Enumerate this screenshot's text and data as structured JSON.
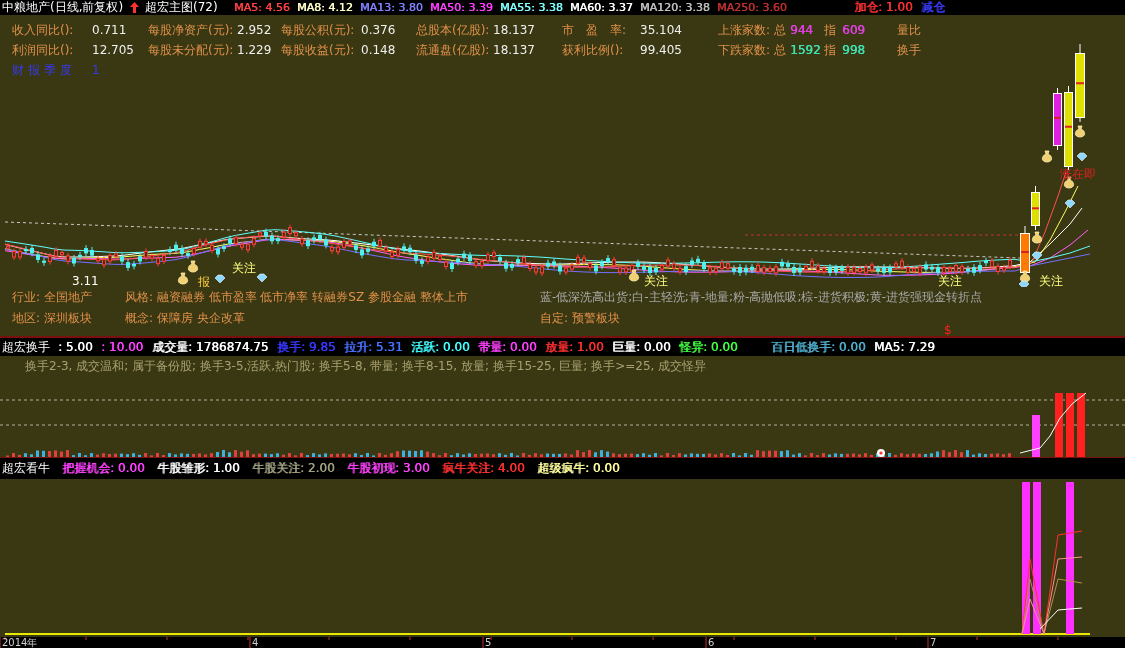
{
  "title_bar": {
    "stock": "中粮地产(日线,前复权)",
    "indicator": "超宏主图(72)",
    "moving_averages": [
      {
        "label": "MA5: 4.56",
        "color": "#ff4040"
      },
      {
        "label": "MA8: 4.12",
        "color": "#ffffc8"
      },
      {
        "label": "MA13: 3.80",
        "color": "#8080ff"
      },
      {
        "label": "MA50: 3.39",
        "color": "#ff40ff"
      },
      {
        "label": "MA55: 3.38",
        "color": "#80ffff"
      },
      {
        "label": "MA60: 3.37",
        "color": "#ffffff"
      },
      {
        "label": "MA120: 3.38",
        "color": "#c0c0c0"
      },
      {
        "label": "MA250: 3.60",
        "color": "#c03030"
      }
    ],
    "signals": [
      {
        "label": "加仓: 1.00",
        "color": "#ff3030"
      },
      {
        "label": "减仓",
        "color": "#3c3cff"
      }
    ]
  },
  "fundamentals": {
    "rows": [
      [
        {
          "label": "收入同比():",
          "value": "0.711"
        },
        {
          "label": "每股净资产(元):",
          "value": "2.952"
        },
        {
          "label": "每股公积(元):",
          "value": "0.376"
        },
        {
          "label": "总股本(亿股):",
          "value": "18.137"
        },
        {
          "label": "市　盈　率:",
          "value": "35.104"
        }
      ],
      [
        {
          "label": "利润同比():",
          "value": "12.705"
        },
        {
          "label": "每股未分配(元):",
          "value": "1.229"
        },
        {
          "label": "每股收益(元):",
          "value": "0.148"
        },
        {
          "label": "流通盘(亿股):",
          "value": "18.137"
        },
        {
          "label": "获利比例():",
          "value": "99.405"
        }
      ]
    ],
    "breadth": [
      {
        "label": "上涨家数: 总",
        "total": "944",
        "index_label": "指",
        "index": "609",
        "color": "#e040e0"
      },
      {
        "label": "下跌家数: 总",
        "total": "1592",
        "index_label": "指",
        "index": "998",
        "color": "#40e0b0"
      }
    ],
    "extra": [
      "量比",
      "换手"
    ],
    "report": {
      "label": "财报季度",
      "value": "1"
    }
  },
  "main_chart": {
    "markers": [
      {
        "kind": "price",
        "label": "3.11"
      },
      {
        "kind": "report",
        "label": "报"
      },
      {
        "kind": "watch",
        "label": "关注"
      },
      {
        "kind": "watch",
        "label": "关注"
      },
      {
        "kind": "watch",
        "label": "关注"
      },
      {
        "kind": "watch",
        "label": "关注"
      },
      {
        "kind": "alert",
        "label": "涨在即"
      }
    ],
    "sector_info": [
      [
        {
          "kind": "tag",
          "text": "行业: 全国地产"
        },
        {
          "kind": "tag",
          "text": "风格: 融资融券 低市盈率 低市净率 转融券SZ 参股金融 整体上市"
        },
        {
          "kind": "legend",
          "text": "蓝-低深洗高出货;白-主轻洗;青-地量;粉-高抛低吸;棕-进货积极;黄-进货强现金转折点"
        }
      ],
      [
        {
          "kind": "tag",
          "text": "地区: 深圳板块"
        },
        {
          "kind": "tag",
          "text": "概念: 保障房 央企改革"
        },
        {
          "kind": "tag",
          "text": "自定: 预警板块"
        }
      ]
    ],
    "signal": "$"
  },
  "turnover_panel": {
    "title": "超宏换手",
    "readouts": [
      {
        "label": ": 5.00",
        "color": "#ffffff"
      },
      {
        "label": ": 10.00",
        "color": "#ff40ff"
      },
      {
        "label": "成交量: 1786874.75",
        "color": "#ffffff"
      },
      {
        "label": "换手: 9.85",
        "color": "#3838ff"
      },
      {
        "label": "拉升: 5.31",
        "color": "#4870ff"
      },
      {
        "label": "活跃: 0.00",
        "color": "#40ffff"
      },
      {
        "label": "带量: 0.00",
        "color": "#ff40ff"
      },
      {
        "label": "放量: 1.00",
        "color": "#ff3030"
      },
      {
        "label": "巨量: 0.00",
        "color": "#ffffff"
      },
      {
        "label": "怪异: 0.00",
        "color": "#40ff40"
      }
    ],
    "right_readouts": [
      {
        "label": "百日低换手: 0.00",
        "color": "#50b0d0"
      },
      {
        "label": "MA5: 7.29",
        "color": "#ffffff"
      }
    ],
    "note": "换手2-3, 成交温和; 属于备份股; 换手3-5,活跃,热门股; 换手5-8, 带量; 换手8-15, 放量; 换手15-25, 巨量; 换手>=25, 成交怪异"
  },
  "bull_panel": {
    "title": "超宏看牛",
    "readouts": [
      {
        "label": "把握机会: 0.00",
        "color": "#ff40ff"
      },
      {
        "label": "牛股雏形: 1.00",
        "color": "#ffffff"
      },
      {
        "label": "牛股关注: 2.00",
        "color": "#a0a080"
      },
      {
        "label": "牛股初现: 3.00",
        "color": "#ff40ff"
      },
      {
        "label": "疯牛关注: 4.00",
        "color": "#ff3030"
      },
      {
        "label": "超级疯牛: 0.00",
        "color": "#ffffa0"
      }
    ]
  },
  "time_axis": {
    "labels": [
      "2014年",
      "4",
      "5",
      "6",
      "7"
    ]
  }
}
